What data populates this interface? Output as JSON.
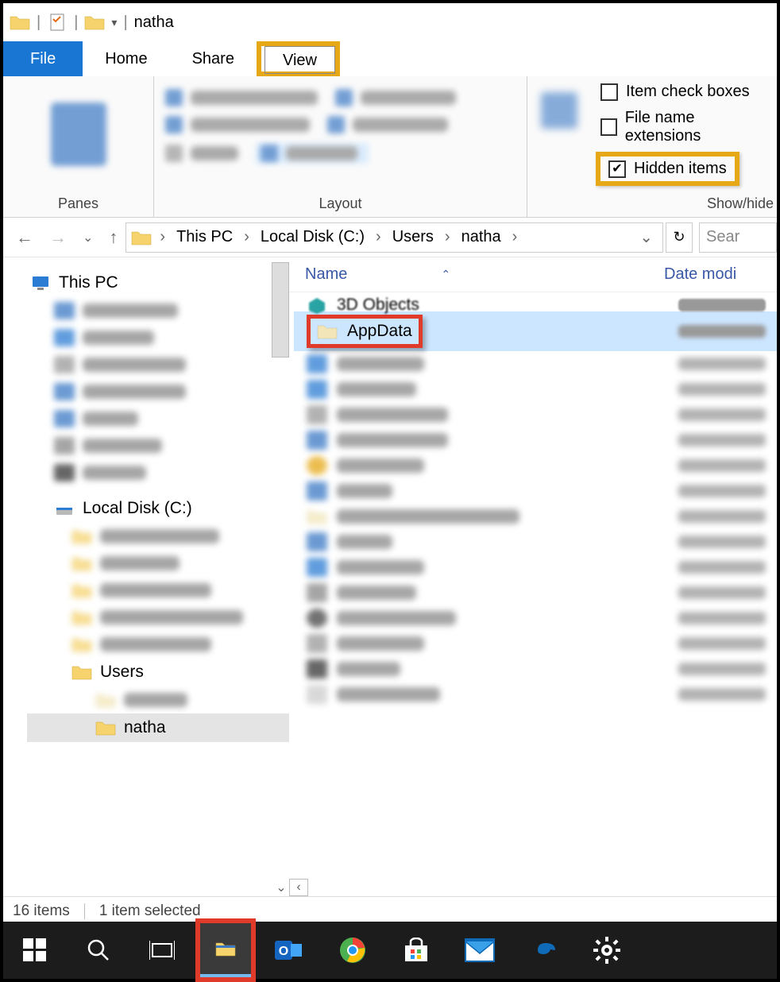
{
  "window": {
    "title": "natha"
  },
  "tabs": {
    "file": "File",
    "home": "Home",
    "share": "Share",
    "view": "View"
  },
  "ribbon": {
    "panes_label": "Panes",
    "layout_label": "Layout",
    "showhide_label": "Show/hide",
    "item_checkboxes": "Item check boxes",
    "file_ext": "File name extensions",
    "hidden_items": "Hidden items"
  },
  "breadcrumb": {
    "items": [
      "This PC",
      "Local Disk (C:)",
      "Users",
      "natha"
    ]
  },
  "search": {
    "placeholder": "Sear"
  },
  "columns": {
    "name": "Name",
    "date": "Date modi"
  },
  "nav": {
    "thispc": "This PC",
    "localdisk": "Local Disk (C:)",
    "users": "Users",
    "natha": "natha"
  },
  "files": {
    "objects3d": "3D Objects",
    "appdata": "AppData"
  },
  "status": {
    "count": "16 items",
    "selected": "1 item selected"
  }
}
